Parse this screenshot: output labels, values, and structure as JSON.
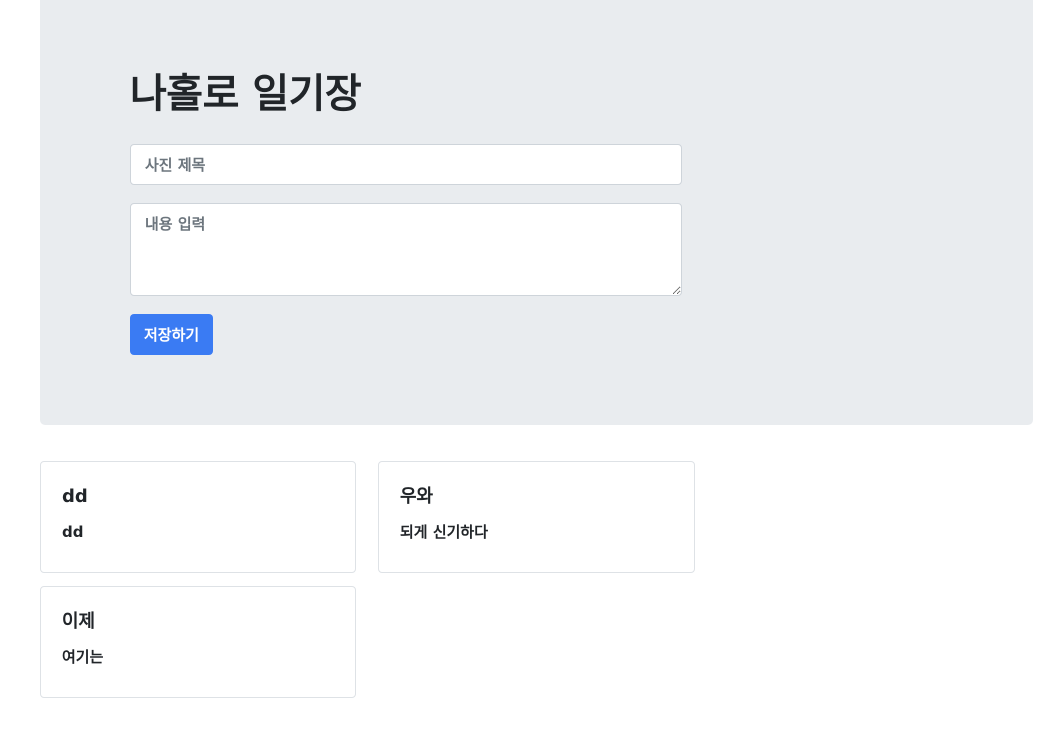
{
  "header": {
    "title": "나홀로 일기장"
  },
  "form": {
    "title_placeholder": "사진 제목",
    "content_placeholder": "내용 입력",
    "title_value": "",
    "content_value": "",
    "save_label": "저장하기"
  },
  "cards": [
    {
      "title": "dd",
      "text": "dd"
    },
    {
      "title": "우와",
      "text": "되게 신기하다"
    },
    {
      "title": "이제",
      "text": "여기는"
    }
  ],
  "colors": {
    "primary": "#3a7bf3",
    "jumbotron_bg": "#e9ecef",
    "border": "#dee2e6"
  }
}
